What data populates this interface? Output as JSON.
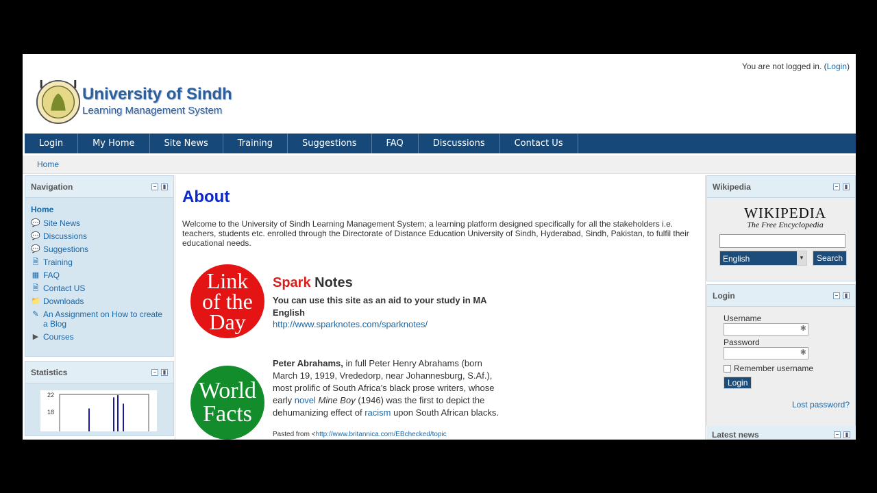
{
  "header": {
    "login_status_text": "You are not logged in. (",
    "login_link": "Login",
    "login_status_end": ")",
    "site_title": "University of Sindh",
    "site_subtitle": "Learning Management System"
  },
  "navbar": [
    "Login",
    "My Home",
    "Site News",
    "Training",
    "Suggestions",
    "FAQ",
    "Discussions",
    "Contact Us"
  ],
  "breadcrumb": "Home",
  "navigation": {
    "title": "Navigation",
    "home": "Home",
    "items": [
      {
        "label": "Site News",
        "icon": "speech-bubble-icon"
      },
      {
        "label": "Discussions",
        "icon": "speech-bubble-icon"
      },
      {
        "label": "Suggestions",
        "icon": "speech-bubble-icon"
      },
      {
        "label": "Training",
        "icon": "page-icon"
      },
      {
        "label": "FAQ",
        "icon": "table-icon"
      },
      {
        "label": "Contact US",
        "icon": "page-icon"
      },
      {
        "label": "Downloads",
        "icon": "folder-icon"
      },
      {
        "label": "An Assignment on How to create a Blog",
        "icon": "assignment-icon"
      },
      {
        "label": "Courses",
        "icon": "triangle-right-icon"
      }
    ]
  },
  "statistics": {
    "title": "Statistics",
    "ticks": [
      "22",
      "18"
    ],
    "bar_heights": [
      0.62,
      0.92,
      0.98,
      0.75
    ]
  },
  "main": {
    "title": "About",
    "intro": "Welcome to the University of Sindh Learning Management System; a learning platform designed specifically for all the stakeholders i.e. teachers, students etc. enrolled through the Directorate of Distance Education University of Sindh, Hyderabad, Sindh, Pakistan, to fulfil their educational needs.",
    "circle1": [
      "Link",
      "of the",
      "Day"
    ],
    "circle2": [
      "World",
      "Facts"
    ],
    "spark_red": "Spark",
    "spark_rest": " Notes",
    "spark_desc": "You can use this site as an aid to your study in MA English",
    "spark_link": "http://www.sparknotes.com/sparknotes/",
    "peter_bold": "Peter Abrahams,",
    "peter_1": " in full Peter Henry Abrahams    (born March 19, 1919, Vrededorp, near Johannesburg, S.Af.), most prolific of South Africa’s black prose writers, whose early ",
    "peter_novel": "novel",
    "peter_2": " ",
    "peter_title": "Mine Boy",
    "peter_3": " (1946) was the first to depict the dehumanizing effect of ",
    "peter_racism": "racism",
    "peter_4": " upon South African blacks.",
    "pasted_prefix": "Pasted from <",
    "pasted_link": "http://www.britannica.com/EBchecked/topic"
  },
  "wikipedia": {
    "title": "Wikipedia",
    "logo_big": "WIKIPEDIA",
    "logo_small": "The Free Encyclopedia",
    "language": "English",
    "search_label": "Search"
  },
  "login": {
    "title": "Login",
    "username_label": "Username",
    "password_label": "Password",
    "remember_label": "Remember username",
    "button_label": "Login",
    "lost_password": "Lost password?"
  },
  "latest_news": {
    "title": "Latest news"
  }
}
